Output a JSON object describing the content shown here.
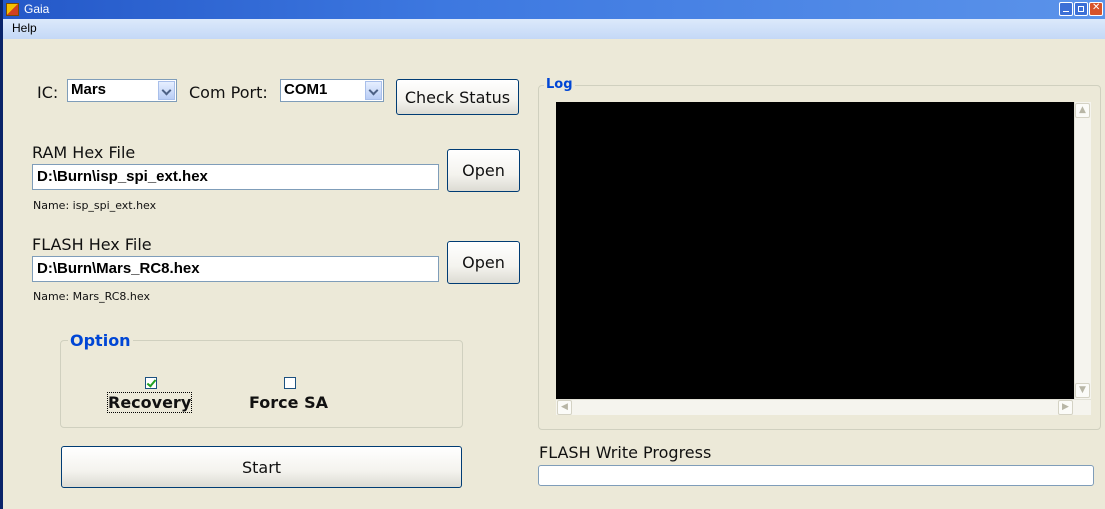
{
  "window": {
    "title": "Gaia"
  },
  "menu": {
    "items": [
      "Help"
    ]
  },
  "ic": {
    "label": "IC:",
    "value": "Mars"
  },
  "comport": {
    "label": "Com Port:",
    "value": "COM1"
  },
  "check_status_label": "Check Status",
  "ram": {
    "label": "RAM Hex File",
    "path": "D:\\Burn\\isp_spi_ext.hex",
    "name_text": "Name: isp_spi_ext.hex",
    "open_label": "Open"
  },
  "flash": {
    "label": "FLASH Hex File",
    "path": "D:\\Burn\\Mars_RC8.hex",
    "name_text": "Name: Mars_RC8.hex",
    "open_label": "Open"
  },
  "option": {
    "title": "Option",
    "recovery": {
      "label": "Recovery",
      "checked": true
    },
    "force_sa": {
      "label": "Force SA",
      "checked": false
    }
  },
  "start_label": "Start",
  "log": {
    "title": "Log"
  },
  "progress": {
    "label": "FLASH Write Progress",
    "value": 0
  },
  "colors": {
    "accent": "#0046d5",
    "titlebar": "#2458c8",
    "log_bg": "#000000"
  }
}
